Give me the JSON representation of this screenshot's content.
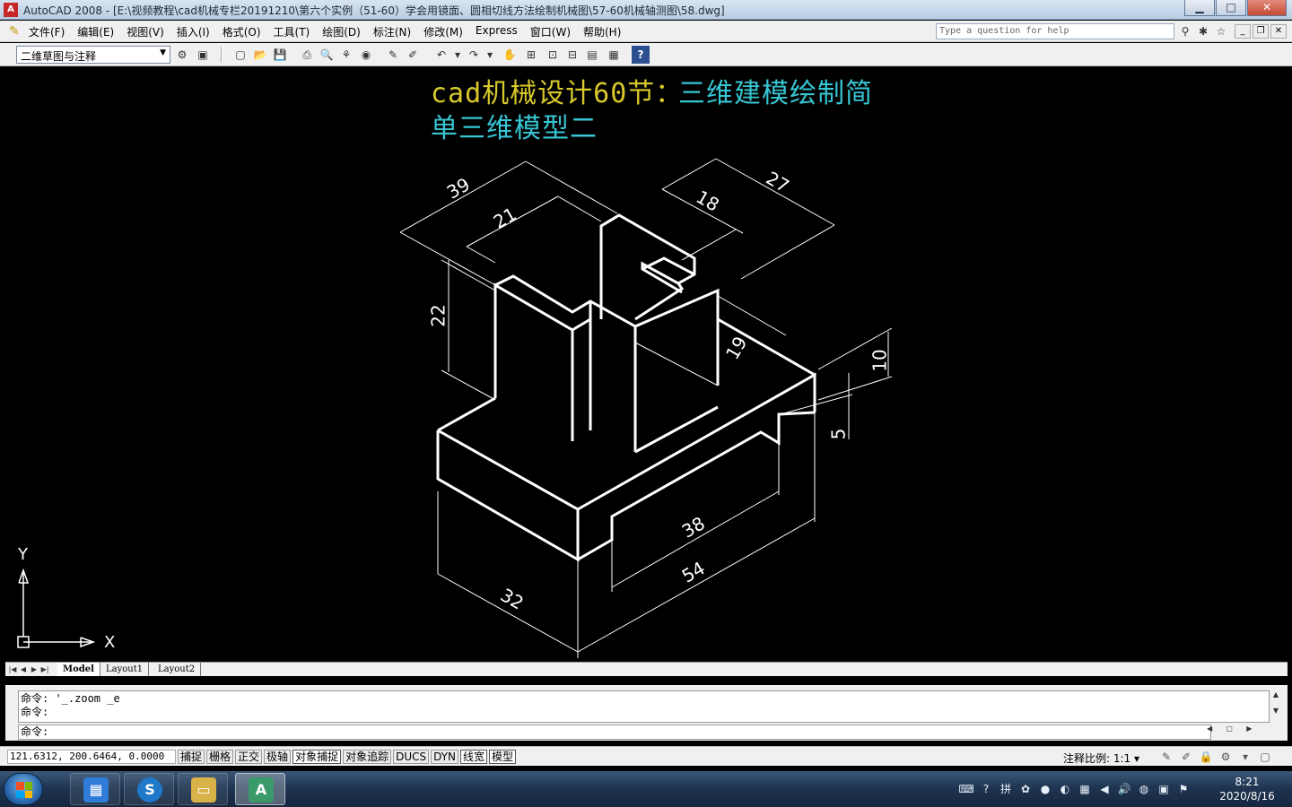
{
  "window": {
    "app_icon_text": "A",
    "title": "AutoCAD 2008 - [E:\\视频教程\\cad机械专栏20191210\\第六个实例（51-60）学会用镜面、圆相切线方法绘制机械图\\57-60机械轴测图\\58.dwg]",
    "controls": {
      "minimize": "▁",
      "maximize": "□",
      "close": "✕"
    }
  },
  "menubar": {
    "items": [
      "文件(F)",
      "编辑(E)",
      "视图(V)",
      "插入(I)",
      "格式(O)",
      "工具(T)",
      "绘图(D)",
      "标注(N)",
      "修改(M)",
      "Express",
      "窗口(W)",
      "帮助(H)"
    ],
    "help_placeholder": "Type a question for help",
    "mdi": {
      "minimize": "_",
      "restore": "❐",
      "close": "✕"
    }
  },
  "toolbar": {
    "workspace": "二维草图与注释"
  },
  "drawing": {
    "title_part1": "cad机械设计60节：",
    "title_part2": "三维建模绘制简",
    "title_line2": "单三维模型二",
    "dimensions": [
      "39",
      "21",
      "27",
      "18",
      "22",
      "19",
      "10",
      "5",
      "38",
      "54",
      "32"
    ],
    "ucs": {
      "x": "X",
      "y": "Y"
    },
    "colors": {
      "background": "#000000",
      "geometry": "#ffffff",
      "title_yellow": "#d9c92b",
      "title_cyan": "#37c6d4"
    }
  },
  "tabs": {
    "model": "Model",
    "layout1": "Layout1",
    "layout2": "Layout2"
  },
  "command": {
    "history": [
      "命令: '_.zoom _e",
      "命令:"
    ],
    "prompt": "命令:"
  },
  "status": {
    "coords": "121.6312, 200.6464, 0.0000",
    "modes": [
      {
        "label": "捕捉",
        "on": false
      },
      {
        "label": "栅格",
        "on": false
      },
      {
        "label": "正交",
        "on": false
      },
      {
        "label": "极轴",
        "on": false
      },
      {
        "label": "对象捕捉",
        "on": true
      },
      {
        "label": "对象追踪",
        "on": false
      },
      {
        "label": "DUCS",
        "on": false
      },
      {
        "label": "DYN",
        "on": false
      },
      {
        "label": "线宽",
        "on": true
      },
      {
        "label": "模型",
        "on": true
      }
    ],
    "annotation_scale_label": "注释比例:",
    "annotation_scale_value": "1:1"
  },
  "taskbar": {
    "time": "8:21",
    "date": "2020/8/16"
  }
}
